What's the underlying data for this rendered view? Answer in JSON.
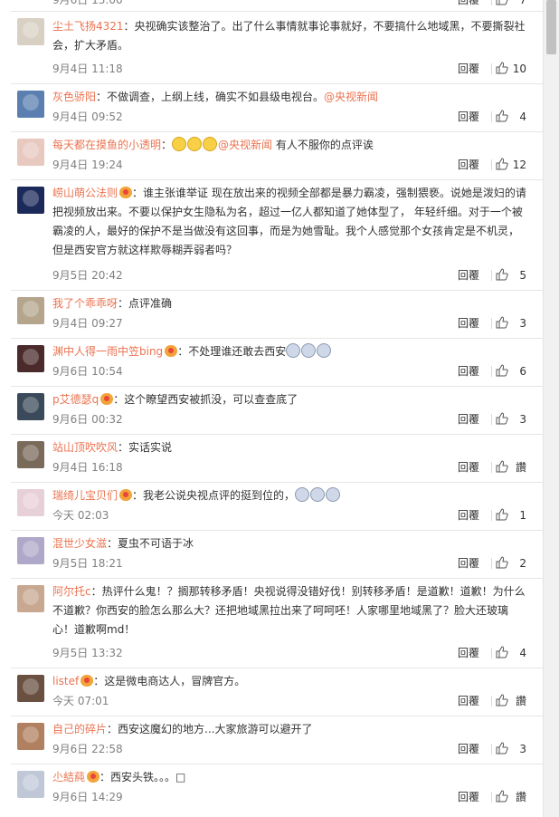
{
  "top_partial": {
    "time": "9月6日 13:00",
    "reply_label": "回覆",
    "likes": "7"
  },
  "comments": [
    {
      "user": "尘土飞扬4321",
      "text": "：央视确实该整治了。出了什么事情就事论事就好，不要搞什么地域黑，不要撕裂社会，扩大矛盾。",
      "time": "9月4日 11:18",
      "reply_label": "回覆",
      "likes": "10"
    },
    {
      "user": "灰色骄阳",
      "text": "：不做调查，上纲上线，确实不如县级电视台。",
      "mention": "@央视新闻",
      "time": "9月4日 09:52",
      "reply_label": "回覆",
      "likes": "4"
    },
    {
      "user": "每天都在摸鱼的小透明",
      "text": "：",
      "mention": "@央视新闻",
      "text2": " 有人不服你的点评诶",
      "time": "9月4日 19:24",
      "reply_label": "回覆",
      "likes": "12"
    },
    {
      "user": "崂山萌公法则",
      "text": "：谁主张谁举证 现在放出来的视频全部都是暴力霸凌，强制猥亵。说她是泼妇的请把视频放出来。不要以保护女生隐私为名，超过一亿人都知道了她体型了， 年轻纤细。对于一个被霸凌的人，最好的保护不是当做没有这回事，而是为她雪耻。我个人感觉那个女孩肯定是不机灵，但是西安官方就这样欺辱糊弄弱者吗？",
      "time": "9月5日 20:42",
      "reply_label": "回覆",
      "likes": "5"
    },
    {
      "user": "我了个乖乖呀",
      "text": "：点评准确",
      "time": "9月4日 09:27",
      "reply_label": "回覆",
      "likes": "3"
    },
    {
      "user": "渊中人得一雨中笠bing",
      "text": "：不处理谁还敢去西安",
      "time": "9月6日 10:54",
      "reply_label": "回覆",
      "likes": "6"
    },
    {
      "user": "p艾德瑟q",
      "text": "：这个瞭望西安被抓没，可以查查底了",
      "time": "9月6日 00:32",
      "reply_label": "回覆",
      "likes": "3"
    },
    {
      "user": "站山顶吹吹风",
      "text": "：实话实说",
      "time": "9月4日 16:18",
      "reply_label": "回覆",
      "likes": "讚"
    },
    {
      "user": "瑞绮儿宝贝们",
      "text": "：我老公说央视点评的挺到位的，",
      "time": "今天 02:03",
      "reply_label": "回覆",
      "likes": "1"
    },
    {
      "user": "混世少女滋",
      "text": "：夏虫不可语于冰",
      "time": "9月5日 18:21",
      "reply_label": "回覆",
      "likes": "2"
    },
    {
      "user": "阿尔托c",
      "text": "：热评什么鬼！？搁那转移矛盾！央视说得没错好伐！别转移矛盾！是道歉！道歉！为什么不道歉？你西安的脸怎么那么大？还把地域黑拉出来了呵呵呸！人家哪里地域黑了？脸大还玻璃心！道歉啊md！",
      "time": "9月5日 13:32",
      "reply_label": "回覆",
      "likes": "4"
    },
    {
      "user": "listef",
      "text": "：这是微电商达人，冒牌官方。",
      "time": "今天 07:01",
      "reply_label": "回覆",
      "likes": "讚"
    },
    {
      "user": "自己的碎片",
      "text": "：西安这魔幻的地方...大家旅游可以避开了",
      "time": "9月6日 22:58",
      "reply_label": "回覆",
      "likes": "3"
    },
    {
      "user": "尐結蒓",
      "text": "：西安头铁。。。□",
      "time": "9月6日 14:29",
      "reply_label": "回覆",
      "likes": "讚"
    }
  ],
  "avatar_colors": [
    "#d9d0c4",
    "#5a7fb0",
    "#e8c9c0",
    "#1b2a5a",
    "#b5a58c",
    "#4a2a2a",
    "#3a4a5a",
    "#7a6a5a",
    "#e8d0d8",
    "#b0a8c8",
    "#c8a890",
    "#6a5040",
    "#b08060",
    "#c0c8d8"
  ],
  "colors": {
    "username": "#eb7350",
    "meta_text": "#808080",
    "separator": "#e6e6e6"
  }
}
